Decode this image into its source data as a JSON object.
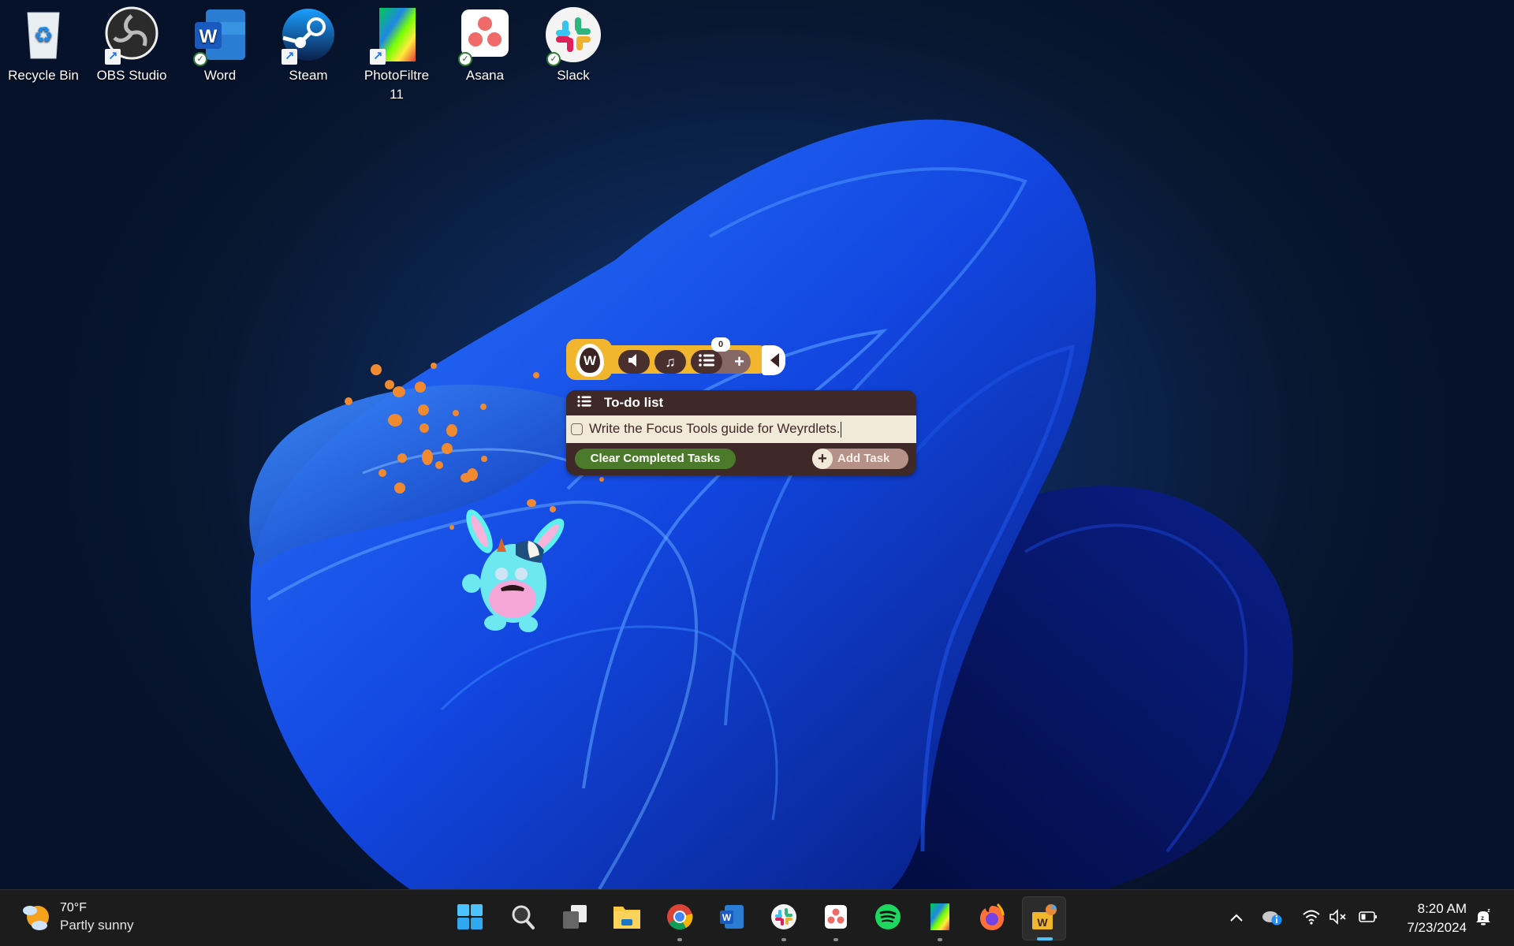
{
  "desktop": {
    "icons": [
      {
        "label": "Recycle Bin",
        "icon": "recycle-bin-icon",
        "badge": "none"
      },
      {
        "label": "OBS Studio",
        "icon": "obs-studio-icon",
        "badge": "shortcut"
      },
      {
        "label": "Word",
        "icon": "word-icon",
        "badge": "synced"
      },
      {
        "label": "Steam",
        "icon": "steam-icon",
        "badge": "shortcut"
      },
      {
        "label": "PhotoFiltre 11",
        "icon": "photofiltre-icon",
        "badge": "shortcut"
      },
      {
        "label": "Asana",
        "icon": "asana-icon",
        "badge": "synced"
      },
      {
        "label": "Slack",
        "icon": "slack-icon",
        "badge": "synced"
      }
    ]
  },
  "widget": {
    "app": "Weyrdlets",
    "logo_letter": "W",
    "toolbar": {
      "sound_icon": "speaker-icon",
      "music_icon": "music-note-icon",
      "tasks_icon": "list-icon",
      "add_icon": "plus-icon",
      "task_count": "0",
      "collapse_icon": "chevron-left-icon"
    },
    "todo": {
      "title": "To-do list",
      "tasks": [
        {
          "text": "Write the Focus Tools guide for Weyrdlets.",
          "checked": false
        }
      ],
      "clear_label": "Clear Completed Tasks",
      "add_label": "Add Task"
    },
    "colors": {
      "accent": "#f2b62e",
      "panel": "#3f2828",
      "clear_button": "#4a7a2a",
      "add_button": "#b69187"
    }
  },
  "taskbar": {
    "weather": {
      "temp": "70°F",
      "condition": "Partly sunny"
    },
    "apps": [
      {
        "name": "Start",
        "icon": "windows-start-icon",
        "state": "none"
      },
      {
        "name": "Search",
        "icon": "search-icon",
        "state": "none"
      },
      {
        "name": "Task View",
        "icon": "task-view-icon",
        "state": "none"
      },
      {
        "name": "File Explorer",
        "icon": "file-explorer-icon",
        "state": "none"
      },
      {
        "name": "Google Chrome",
        "icon": "chrome-icon",
        "state": "running"
      },
      {
        "name": "Word",
        "icon": "word-icon",
        "state": "none"
      },
      {
        "name": "Slack",
        "icon": "slack-icon",
        "state": "running"
      },
      {
        "name": "Asana",
        "icon": "asana-icon",
        "state": "running"
      },
      {
        "name": "Spotify",
        "icon": "spotify-icon",
        "state": "none"
      },
      {
        "name": "PhotoFiltre 11",
        "icon": "photofiltre-icon",
        "state": "running"
      },
      {
        "name": "Firefox",
        "icon": "firefox-icon",
        "state": "none"
      },
      {
        "name": "Weyrdlets",
        "icon": "weyrdlets-icon",
        "state": "active"
      }
    ],
    "tray": {
      "overflow_icon": "chevron-up-icon",
      "onedrive_icon": "onedrive-info-icon",
      "wifi_icon": "wifi-icon",
      "volume_icon": "volume-muted-icon",
      "battery_icon": "battery-icon",
      "time": "8:20 AM",
      "date": "7/23/2024",
      "notification_icon": "notification-bell-snooze-icon"
    }
  }
}
